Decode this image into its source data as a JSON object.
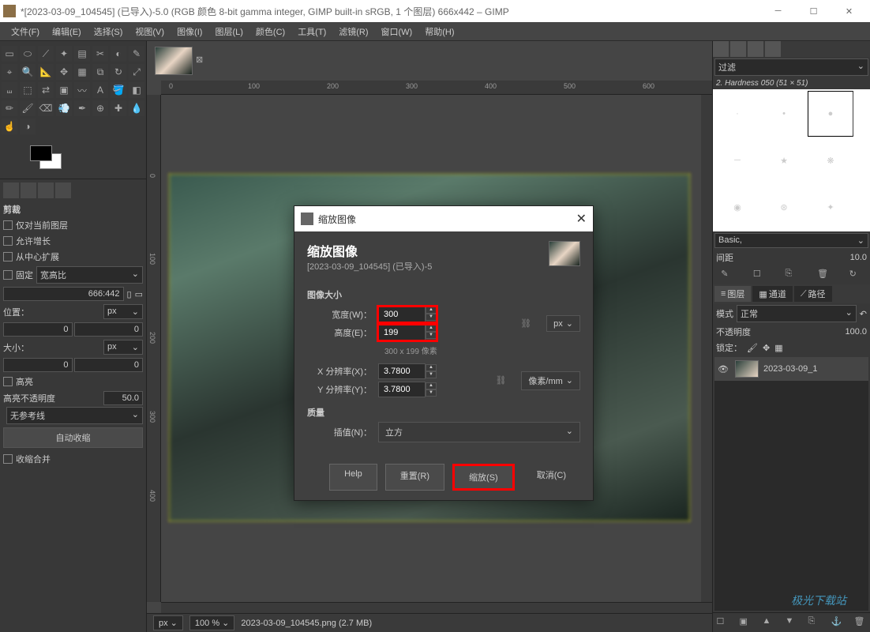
{
  "titlebar": {
    "text": "*[2023-03-09_104545] (已导入)-5.0 (RGB 颜色 8-bit gamma integer, GIMP built-in sRGB, 1 个图层) 666x442 – GIMP"
  },
  "menu": [
    "文件(F)",
    "编辑(E)",
    "选择(S)",
    "视图(V)",
    "图像(I)",
    "图层(L)",
    "颜色(C)",
    "工具(T)",
    "滤镜(R)",
    "窗口(W)",
    "帮助(H)"
  ],
  "tool_options": {
    "title": "剪裁",
    "checks": [
      "仅对当前图层",
      "允许增长",
      "从中心扩展"
    ],
    "fixed_label": "固定",
    "fixed_value": "宽高比",
    "ratio": "666:442",
    "position_label": "位置：",
    "position_unit": "px",
    "pos_x": "0",
    "pos_y": "0",
    "size_label": "大小：",
    "size_unit": "px",
    "size_w": "0",
    "size_h": "0",
    "highlight_label": "高亮",
    "highlight_opacity_label": "高亮不透明度",
    "highlight_opacity": "50.0",
    "guides": "无参考线",
    "auto_shrink": "自动收缩",
    "shrink_merged": "收缩合并"
  },
  "ruler_h": [
    "0",
    "100",
    "200",
    "300",
    "400",
    "500",
    "600"
  ],
  "ruler_v": [
    "0",
    "100",
    "200",
    "300",
    "400"
  ],
  "statusbar": {
    "unit": "px",
    "zoom": "100 %",
    "file": "2023-03-09_104545.png (2.7 MB)"
  },
  "brushes": {
    "filter": "过滤",
    "info": "2. Hardness 050 (51 × 51)",
    "preset": "Basic,",
    "spacing_label": "间距",
    "spacing_value": "10.0"
  },
  "layers": {
    "tabs": [
      "图层",
      "通道",
      "路径"
    ],
    "mode_label": "模式",
    "mode_value": "正常",
    "opacity_label": "不透明度",
    "opacity_value": "100.0",
    "lock_label": "锁定：",
    "layer_name": "2023-03-09_1"
  },
  "dialog": {
    "title": "缩放图像",
    "header": "缩放图像",
    "subheader": "[2023-03-09_104545] (已导入)-5",
    "section_size": "图像大小",
    "width_label": "宽度(W)：",
    "width_value": "300",
    "height_label": "高度(E)：",
    "height_value": "199",
    "hint": "300 x 199 像素",
    "unit_px": "px",
    "xres_label": "X 分辨率(X)：",
    "xres_value": "3.7800",
    "yres_label": "Y 分辨率(Y)：",
    "yres_value": "3.7800",
    "unit_res": "像素/mm",
    "section_quality": "质量",
    "interp_label": "插值(N)：",
    "interp_value": "立方",
    "btn_help": "Help",
    "btn_reset": "重置(R)",
    "btn_scale": "缩放(S)",
    "btn_cancel": "取消(C)"
  },
  "watermark": "极光下载站"
}
